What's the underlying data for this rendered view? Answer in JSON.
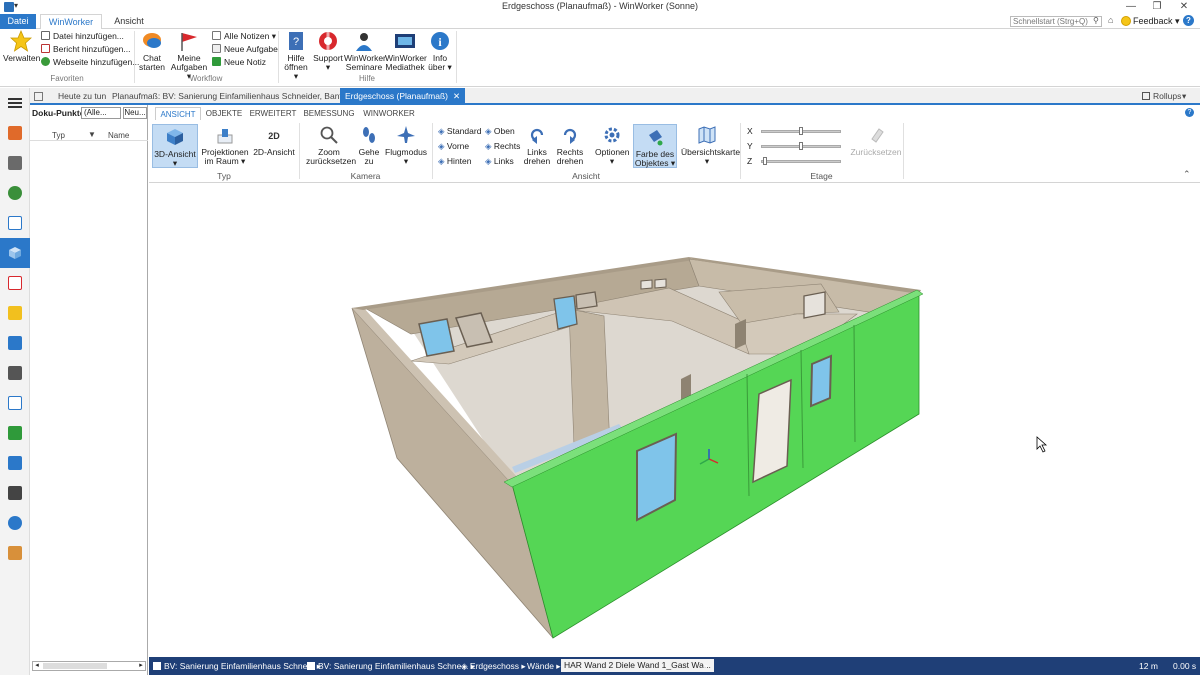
{
  "window": {
    "title": "Erdgeschoss (Planaufmaß) - WinWorker (Sonne)",
    "min": "—",
    "max": "❐",
    "close": "✕"
  },
  "menu": {
    "datei": "Datei",
    "winworker": "WinWorker",
    "ansicht": "Ansicht"
  },
  "topbar": {
    "search_placeholder": "Schnellstart (Strg+Q)",
    "feedback": "Feedback"
  },
  "ribbon": {
    "favoriten": {
      "label": "Favoriten",
      "verwalten": "Verwalten",
      "datei_hinzu": "Datei hinzufügen...",
      "bericht_hinzu": "Bericht hinzufügen...",
      "webseite_hinzu": "Webseite hinzufügen..."
    },
    "workflow": {
      "label": "Workflow",
      "chat": "Chat starten",
      "aufgaben": "Meine Aufgaben",
      "alle_notizen": "Alle Notizen",
      "neue_aufgabe": "Neue Aufgabe",
      "neue_notiz": "Neue Notiz"
    },
    "hilfe": {
      "label": "Hilfe",
      "hilfe_oeffnen": "Hilfe öffnen",
      "support": "Support",
      "seminare": "WinWorker Seminare",
      "mediathek": "WinWorker Mediathek",
      "info": "Info über"
    }
  },
  "doctabs": {
    "heute": "Heute zu tun",
    "planaufmass": "Planaufmaß: BV: Sanierung Einfamilienhaus Schneider, Bantern",
    "erdgeschoss": "Erdgeschoss (Planaufmaß)",
    "rollups": "Rollups"
  },
  "docpanel": {
    "label": "Doku-Punkte:",
    "select": "(Alle...",
    "neu": "Neu...",
    "col_typ": "Typ",
    "col_name": "Name"
  },
  "ribbon2": {
    "tabs": [
      "ANSICHT",
      "OBJEKTE",
      "ERWEITERT",
      "BEMESSUNG",
      "WINWORKER"
    ],
    "typ": {
      "label": "Typ",
      "ansicht3d": "3D-Ansicht",
      "projektionen": "Projektionen im Raum",
      "ansicht2d": "2D-Ansicht"
    },
    "kamera": {
      "label": "Kamera",
      "zoom": "Zoom zurücksetzen",
      "gehe": "Gehe zu",
      "flug": "Flugmodus"
    },
    "ansicht": {
      "label": "Ansicht",
      "standard": "Standard",
      "vorne": "Vorne",
      "hinten": "Hinten",
      "oben": "Oben",
      "rechts": "Rechts",
      "links": "Links",
      "links_drehen": "Links drehen",
      "rechts_drehen": "Rechts drehen",
      "optionen": "Optionen",
      "farbe": "Farbe des Objektes",
      "uebersicht": "Übersichtskarte"
    },
    "etage": {
      "label": "Etage",
      "x": "X",
      "y": "Y",
      "z": "Z",
      "zuruecksetzen": "Zurücksetzen",
      "x_level": 0.5,
      "y_level": 0.5,
      "z_level": 0.02
    }
  },
  "statusbar": {
    "items": [
      "BV: Sanierung Einfamilienhaus Schne...",
      "BV: Sanierung Einfamilienhaus Schne...",
      "Erdgeschoss",
      "Wände"
    ],
    "active": "HAR Wand 2  Diele Wand 1_Gast Wa...",
    "more": ">",
    "scale": "12 m",
    "time": "0.00 s"
  },
  "colors": {
    "accent": "#2b78c9",
    "selected_wall": "#55d655",
    "wall": "#b8aa96",
    "floor": "#dad5cd",
    "window_glass": "#7fc4ea"
  }
}
